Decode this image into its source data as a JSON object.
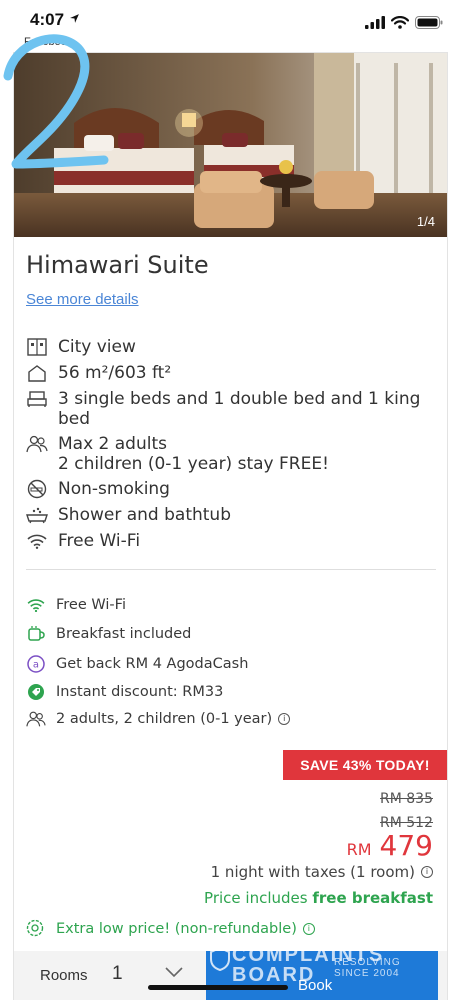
{
  "status_bar": {
    "time": "4:07",
    "back_app": "Facebook"
  },
  "room": {
    "photo_counter": "1/4",
    "title": "Himawari Suite",
    "details_link": "See more details"
  },
  "features": [
    {
      "icon": "window-view-icon",
      "text": "City view"
    },
    {
      "icon": "house-size-icon",
      "text": "56 m²/603 ft²"
    },
    {
      "icon": "bed-icon",
      "text": "3 single beds and 1 double bed and 1 king bed"
    },
    {
      "icon": "people-icon",
      "text": "Max 2 adults",
      "sub": "2 children (0-1 year) stay FREE!"
    },
    {
      "icon": "no-smoking-icon",
      "text": "Non-smoking"
    },
    {
      "icon": "bathtub-icon",
      "text": "Shower and bathtub"
    },
    {
      "icon": "wifi-icon",
      "text": "Free Wi-Fi"
    }
  ],
  "perks": [
    {
      "icon": "wifi-icon",
      "text": "Free Wi-Fi"
    },
    {
      "icon": "coffee-cup-icon",
      "text": "Breakfast included"
    },
    {
      "icon": "agodacash-icon",
      "text": "Get back RM 4 AgodaCash"
    },
    {
      "icon": "discount-tag-icon",
      "text": "Instant discount: RM33"
    },
    {
      "icon": "people-icon",
      "text": "2 adults, 2 children (0-1 year)"
    }
  ],
  "pricing": {
    "save_badge": "SAVE 43% TODAY!",
    "original_price_1": "RM 835",
    "original_price_2": "RM 512",
    "currency": "RM",
    "price": "479",
    "night_text": "1 night with taxes (1 room)",
    "includes_prefix": "Price includes ",
    "includes_bold": "free breakfast"
  },
  "low_price_note": "Extra low price! (non-refundable)",
  "booking": {
    "rooms_label": "Rooms",
    "rooms_value": "1",
    "book_label": "Book"
  },
  "watermark": {
    "main": "COMPLAINTS BOARD",
    "sub": "RESOLVING SINCE 2004"
  },
  "colors": {
    "accent_blue": "#1e7ad8",
    "link_blue": "#4b86d6",
    "sale_red": "#e0363c",
    "green": "#2ea44f",
    "scribble_blue": "#6ec3f0"
  }
}
